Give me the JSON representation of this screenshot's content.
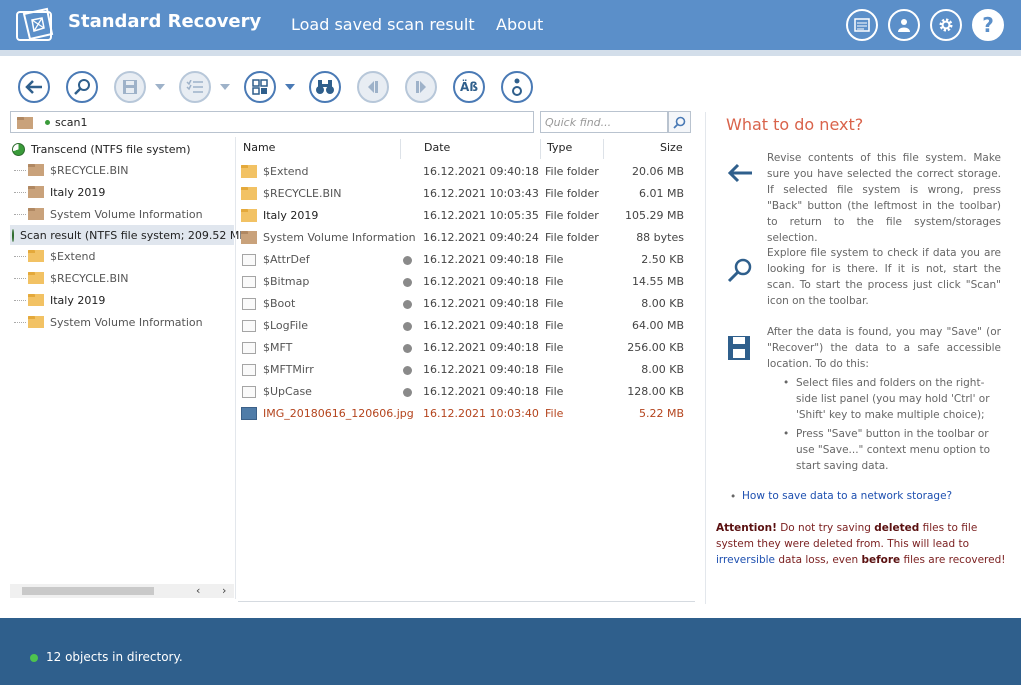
{
  "header": {
    "brand": "Standard Recovery",
    "nav": [
      "Load saved scan result",
      "About"
    ],
    "help_label": "?",
    "colors": {
      "bar": "#5b8fc9",
      "status": "#2f5f8c",
      "accent": "#d9634b"
    }
  },
  "toolbar": {
    "buttons": [
      "back-icon",
      "scan-icon",
      "save-icon",
      "check-list-icon",
      "view-mode-icon",
      "find-icon",
      "prev-icon",
      "next-icon",
      "case-icon",
      "info-icon"
    ],
    "case_label": "Äß"
  },
  "path": {
    "value": "scan1"
  },
  "quick_find": {
    "placeholder": "Quick find..."
  },
  "tree": {
    "items": [
      {
        "label": "Transcend (NTFS file system)"
      },
      {
        "label": "$RECYCLE.BIN"
      },
      {
        "label": "Italy 2019"
      },
      {
        "label": "System Volume Information"
      },
      {
        "label": "Scan result (NTFS file system; 209.52 MB"
      },
      {
        "label": "$Extend"
      },
      {
        "label": "$RECYCLE.BIN"
      },
      {
        "label": "Italy 2019"
      },
      {
        "label": "System Volume Information"
      }
    ]
  },
  "list": {
    "columns": [
      "Name",
      "Date",
      "Type",
      "Size"
    ],
    "rows": [
      {
        "name": "$Extend",
        "date": "16.12.2021 09:40:18",
        "type": "File folder",
        "size": "20.06 MB"
      },
      {
        "name": "$RECYCLE.BIN",
        "date": "16.12.2021 10:03:43",
        "type": "File folder",
        "size": "6.01 MB"
      },
      {
        "name": "Italy 2019",
        "date": "16.12.2021 10:05:35",
        "type": "File folder",
        "size": "105.29 MB"
      },
      {
        "name": "System Volume Information",
        "date": "16.12.2021 09:40:24",
        "type": "File folder",
        "size": "88 bytes"
      },
      {
        "name": "$AttrDef",
        "date": "16.12.2021 09:40:18",
        "type": "File",
        "size": "2.50 KB"
      },
      {
        "name": "$Bitmap",
        "date": "16.12.2021 09:40:18",
        "type": "File",
        "size": "14.55 MB"
      },
      {
        "name": "$Boot",
        "date": "16.12.2021 09:40:18",
        "type": "File",
        "size": "8.00 KB"
      },
      {
        "name": "$LogFile",
        "date": "16.12.2021 09:40:18",
        "type": "File",
        "size": "64.00 MB"
      },
      {
        "name": "$MFT",
        "date": "16.12.2021 09:40:18",
        "type": "File",
        "size": "256.00 KB"
      },
      {
        "name": "$MFTMirr",
        "date": "16.12.2021 09:40:18",
        "type": "File",
        "size": "8.00 KB"
      },
      {
        "name": "$UpCase",
        "date": "16.12.2021 09:40:18",
        "type": "File",
        "size": "128.00 KB"
      },
      {
        "name": "IMG_20180616_120606.jpg",
        "date": "16.12.2021 10:03:40",
        "type": "File",
        "size": "5.22 MB"
      }
    ]
  },
  "help": {
    "title": "What to do next?",
    "p1": "Revise contents of this file system. Make sure you have selected the correct storage. If selected file system is wrong, press \"Back\" button (the leftmost in the toolbar) to return to the file system/storages selection.",
    "p2": "Explore file system to check if data you are looking for is there. If it is not, start the scan. To start the process just click \"Scan\" icon on the toolbar.",
    "p3": "After the data is found, you may \"Save\" (or \"Recover\") the data to a safe accessible location. To do this:",
    "b1": "Select files and folders on the right-side list panel (you may hold 'Ctrl' or 'Shift' key to make multiple choice);",
    "b2": "Press \"Save\" button in the toolbar or use \"Save...\" context menu option to start saving data.",
    "link": "How to save data to a network storage?",
    "att_1": "Attention!",
    "att_2": " Do not try saving ",
    "att_3": "deleted",
    "att_4": " files to file system they were deleted from. This will lead to ",
    "att_5": "irreversible",
    "att_6": " data loss, even ",
    "att_7": "before",
    "att_8": " files are recovered!"
  },
  "status": {
    "text": "12 objects in directory."
  }
}
